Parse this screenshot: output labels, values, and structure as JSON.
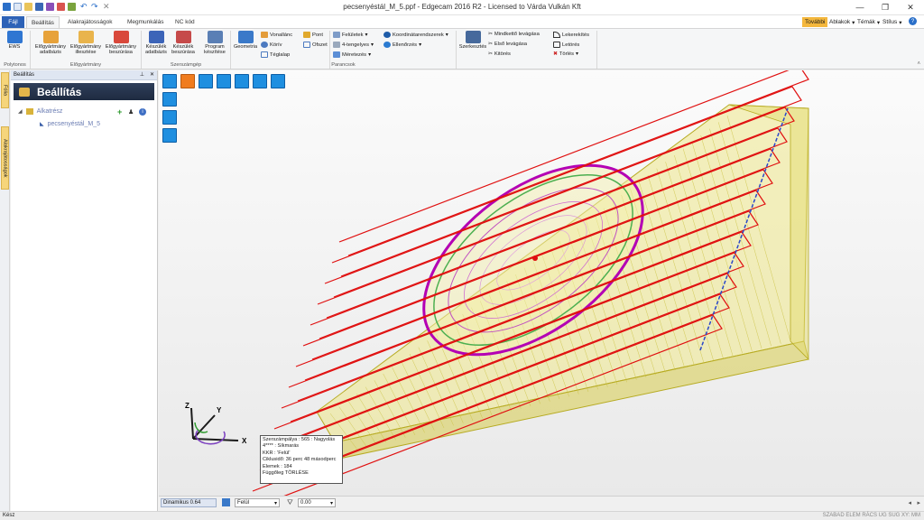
{
  "window": {
    "title": "pecsenyéstál_M_5.ppf - Edgecam 2016 R2 - Licensed to Várda Vulkán Kft"
  },
  "tabs": [
    "Fájl",
    "Beállítás",
    "Alakrajátosságok",
    "Megmunkálás",
    "NC kód"
  ],
  "right_menu": {
    "tovabbi": "További",
    "ablakok": "Ablakok",
    "temak": "Témák",
    "stilus": "Stílus"
  },
  "ribbon": {
    "ews": "EWS",
    "group_polytonos": "Polytonos",
    "elogy_adatbazis": "Előgyártmány adatbázis",
    "elogy_illesztese": "Előgyártmány illesztése",
    "elogy_beszurasa": "Előgyártmány beszúrása",
    "group_elogyartmany": "Előgyártmány",
    "keszulek_adatbazis": "Készülék adatbázis",
    "keszulek_beszurasa": "Készülék beszúrása",
    "program_keszitese": "Program készítése",
    "group_szerszamgep": "Szerszámgép",
    "geometria": "Geometria",
    "vonallanc": "Vonallánc",
    "korív": "Körív",
    "teglalap": "Téglalap",
    "pont": "Pont",
    "ofszet": "Ofszet",
    "feluletek": "Felületek",
    "tengelyes": "4-tengelyes",
    "meretezes": "Méretezés",
    "koordinatarendszerek": "Koordinátarendszerek",
    "ellenorzes": "Ellenőrzés",
    "group_parancsok": "Parancsok",
    "szerkesztes": "Szerkesztés",
    "mindketto": "Mindkettő levágása",
    "elso": "Első levágása",
    "kitores": "Kitörés",
    "lekerekites": "Lekerekítés",
    "letores": "Letörés",
    "torles": "Törlés"
  },
  "left_tabs": [
    "Fólia",
    "Alakrajátosságok"
  ],
  "panel": {
    "header": "Beállítás",
    "title": "Beállítás",
    "tree": [
      "Alkatrész",
      "pecsenyéstál_M_5"
    ]
  },
  "viewport": {
    "axes": {
      "x": "X",
      "y": "Y",
      "z": "Z"
    },
    "info_lines": [
      "Szerszámpálya : 565 : Nagyolás",
      "4**** : Síkmarás",
      "KKR          : 'Felül'",
      "Ciklusidő: 36 perc 48 másodperc",
      "Elemek      : 184",
      "Függőleg TÖRLÉSE"
    ]
  },
  "bottom": {
    "dynamic": "Dinamikus 0.64",
    "view": "Felül",
    "value": "0.00"
  },
  "status": {
    "left": "Kész",
    "right": "SZABAD ELEM RÁCS UG SUG XY: MM"
  }
}
